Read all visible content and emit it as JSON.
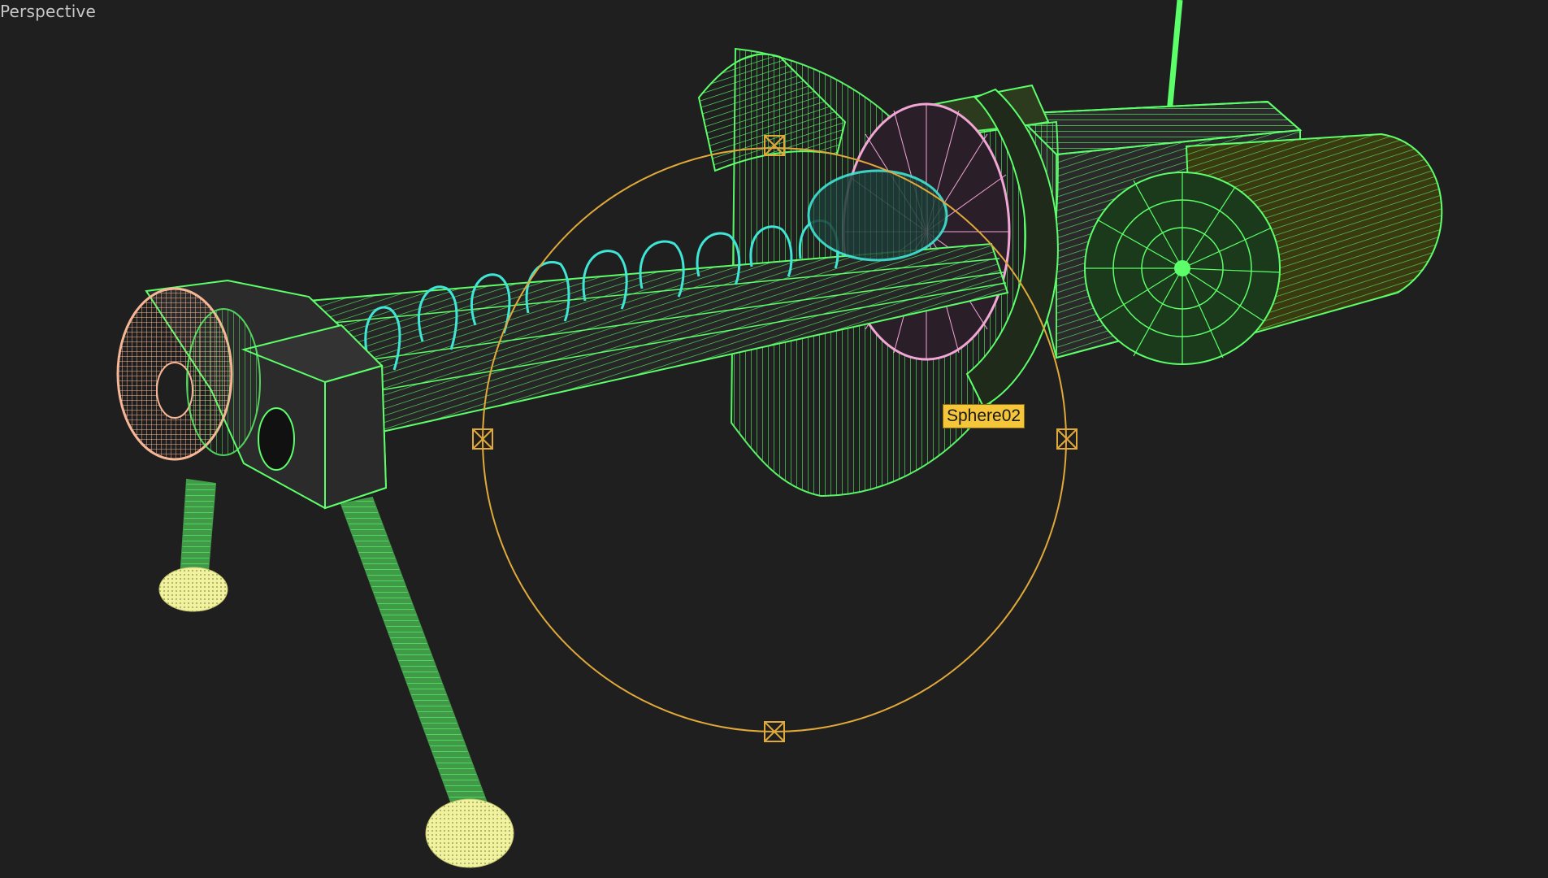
{
  "viewport": {
    "label": "Perspective",
    "background": "#1f1f1f"
  },
  "selection": {
    "tooltip": "Sphere02",
    "gizmo_color": "#e0a93a"
  },
  "colors": {
    "wire_green": "#5cff6a",
    "wire_cyan": "#3fe6d6",
    "wire_pink": "#f2a6d6",
    "wire_peach": "#f7b796",
    "wire_yellow": "#f0f2a0",
    "mesh_dark": "#262626"
  }
}
